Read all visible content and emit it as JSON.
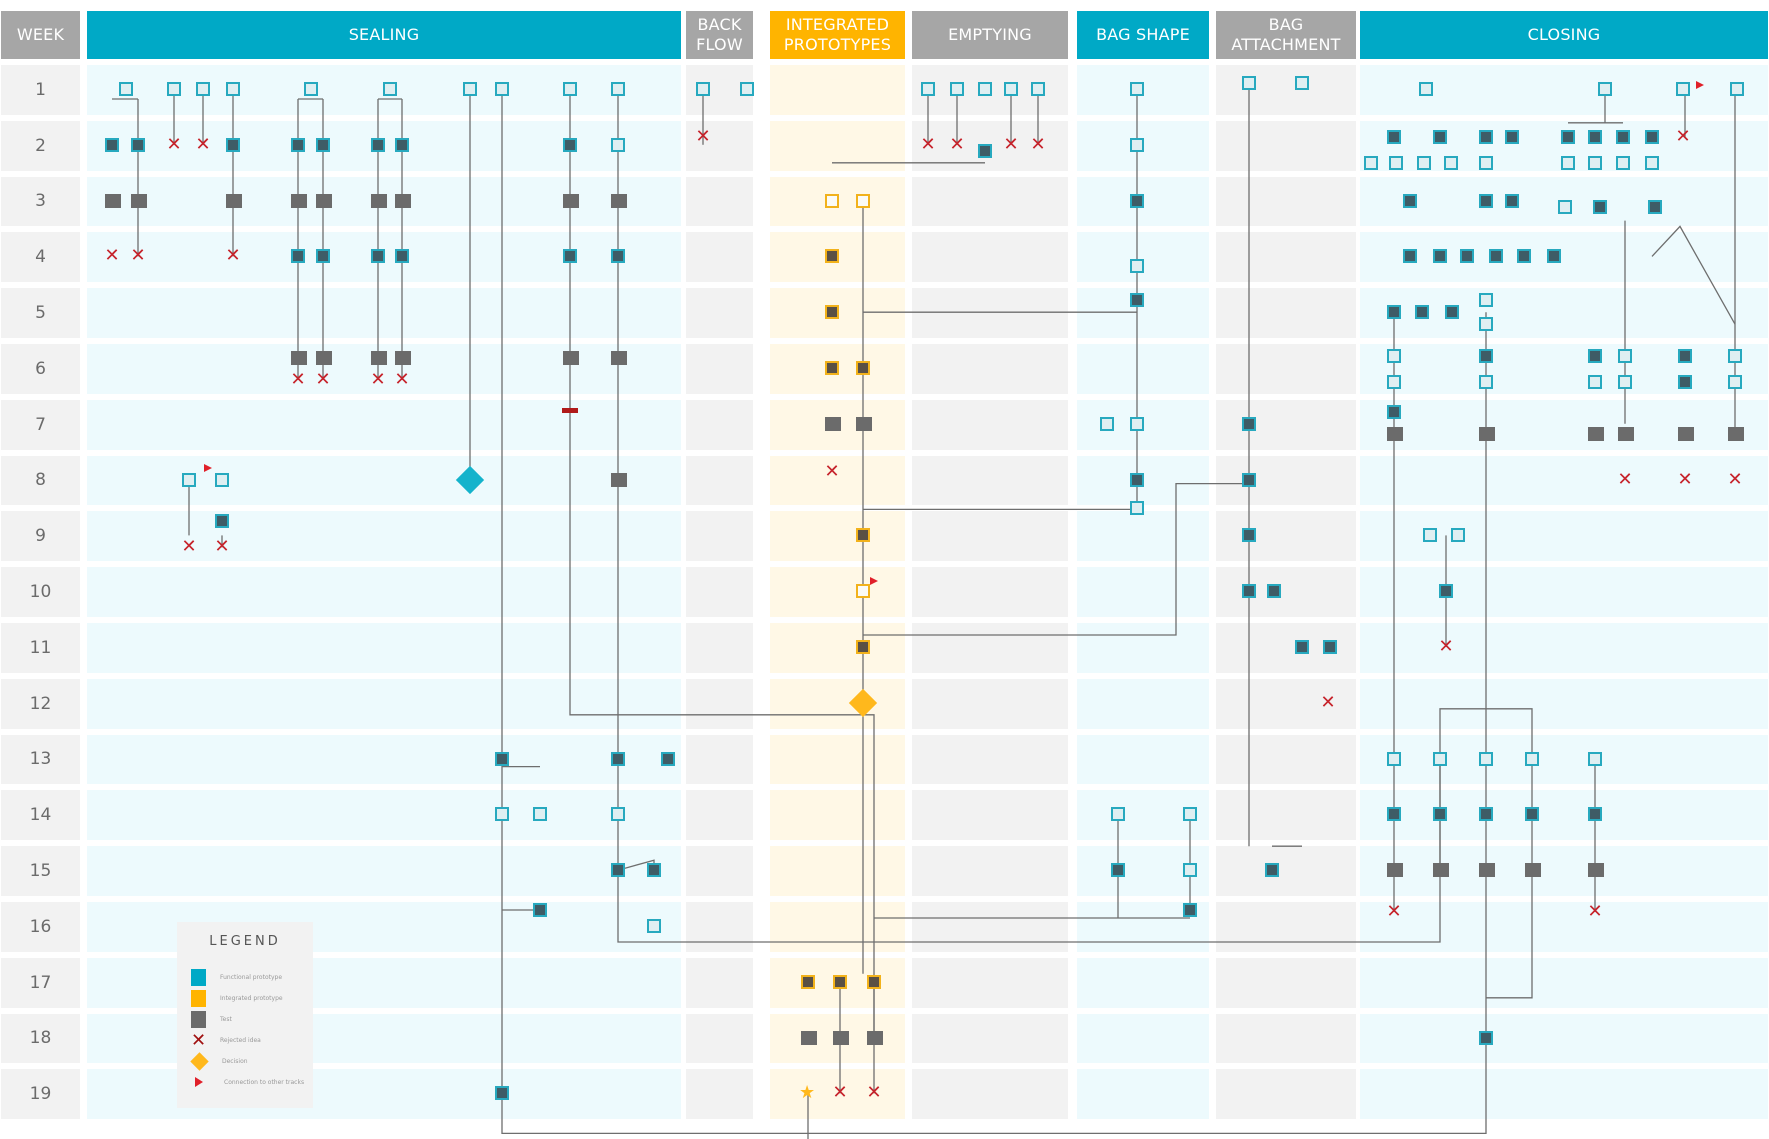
{
  "headers": {
    "week": "WEEK",
    "sealing": "SEALING",
    "back_flow": "BACK FLOW",
    "integrated_prototypes": "INTEGRATED PROTOTYPES",
    "emptying": "EMPTYING",
    "bag_shape": "BAG SHAPE",
    "bag_attachment": "BAG ATTACHMENT",
    "closing": "CLOSING"
  },
  "weeks": [
    "1",
    "2",
    "3",
    "4",
    "5",
    "6",
    "7",
    "8",
    "9",
    "10",
    "11",
    "12",
    "13",
    "14",
    "15",
    "16",
    "17",
    "18",
    "19"
  ],
  "legend": {
    "title": "LEGEND",
    "items": [
      {
        "label": "Functional prototype",
        "kind": "teal-square",
        "color": "#00a9c6"
      },
      {
        "label": "Integrated prototype",
        "kind": "yellow-square",
        "color": "#ffb400"
      },
      {
        "label": "Test",
        "kind": "grey-square",
        "color": "#6b6b6b"
      },
      {
        "label": "Rejected idea",
        "kind": "red-x",
        "color": "#c6232b"
      },
      {
        "label": "Decision",
        "kind": "diamond",
        "color": "#ffb81c"
      },
      {
        "label": "Connection to other tracks",
        "kind": "red-flag",
        "color": "#e0202a"
      }
    ]
  },
  "colors": {
    "teal": "#00a9c6",
    "grey_header": "#a6a6a6",
    "yellow": "#ffb400",
    "reject": "#c6232b",
    "link": "#6e6e6e"
  }
}
